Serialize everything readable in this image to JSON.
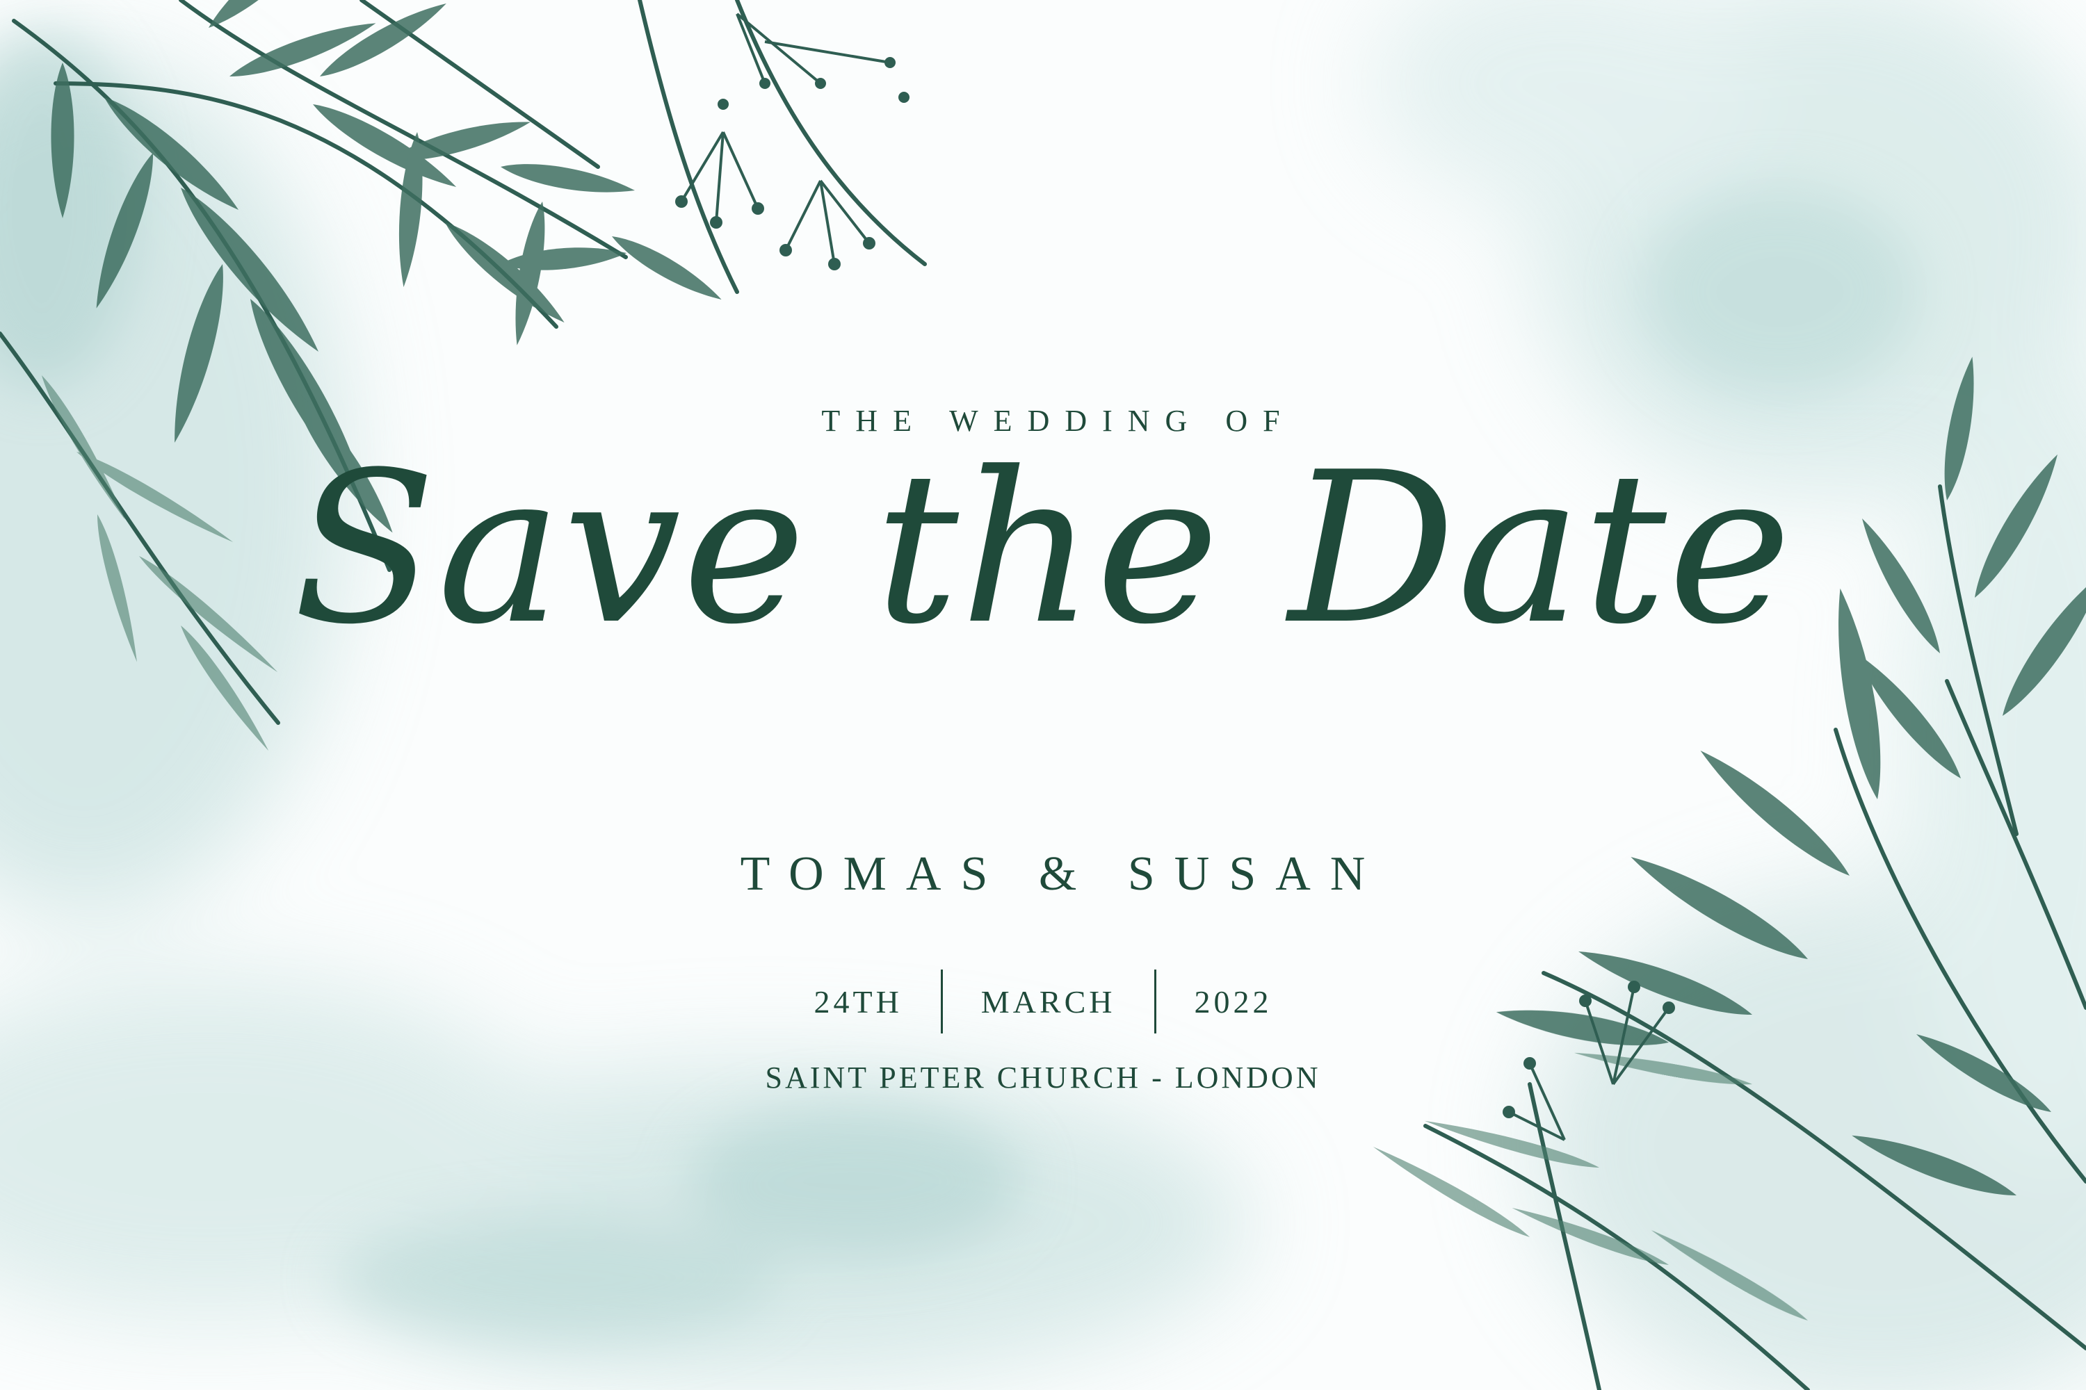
{
  "invitation": {
    "eyebrow": "THE WEDDING OF",
    "title": "Save the Date",
    "names": "TOMAS & SUSAN",
    "date": {
      "day": "24TH",
      "month": "MARCH",
      "year": "2022"
    },
    "venue": "SAINT PETER CHURCH - LONDON"
  },
  "colors": {
    "ink": "#1f4a3a",
    "leaf_dark": "#2f5e52",
    "leaf_mid": "#4f8070",
    "wash": "#b8d8d6",
    "background": "#fbfdfd"
  },
  "decor": {
    "top_left": "watercolor-leaves-icon",
    "bottom_right": "watercolor-leaves-icon",
    "background": "watercolor-wash"
  }
}
